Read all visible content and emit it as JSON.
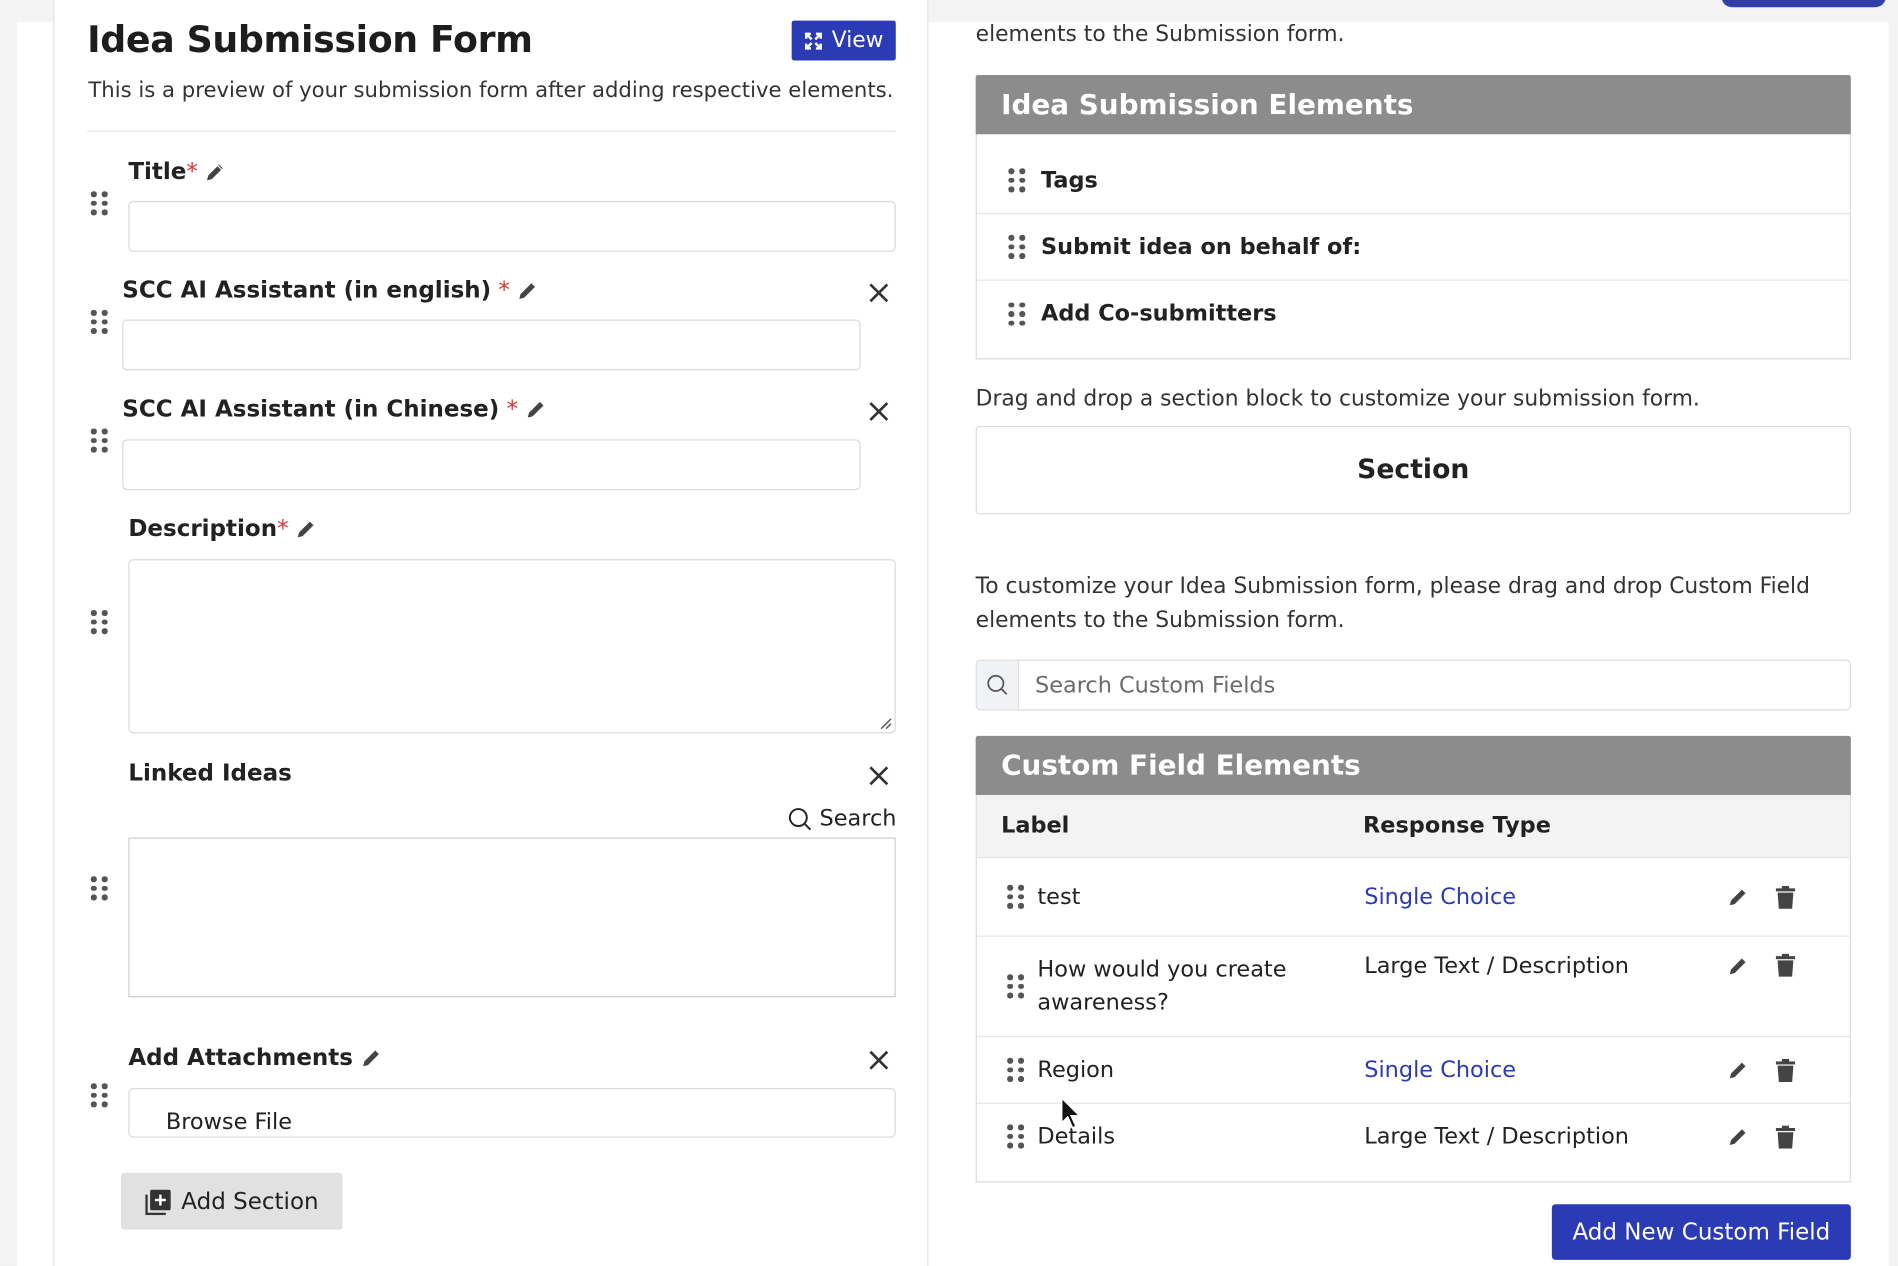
{
  "form": {
    "title": "Idea Submission Form",
    "subtitle": "This is a preview of your submission form after adding respective elements.",
    "view_label": "View",
    "add_section_label": "Add Section",
    "fields": {
      "title": {
        "label": "Title",
        "required_mark": "*"
      },
      "ai_en": {
        "label": "SCC AI Assistant (in english)",
        "required_mark": "*"
      },
      "ai_cn": {
        "label": "SCC AI Assistant (in Chinese)",
        "required_mark": "*"
      },
      "description": {
        "label": "Description",
        "required_mark": "*"
      },
      "linked": {
        "label": "Linked Ideas",
        "search_label": "Search"
      },
      "attachments": {
        "label": "Add Attachments",
        "browse_label": "Browse File"
      }
    }
  },
  "right": {
    "top_text": "elements to the Submission form.",
    "elements_panel": {
      "title": "Idea Submission Elements",
      "items": [
        "Tags",
        "Submit idea on behalf of:",
        "Add Co-submitters"
      ]
    },
    "drag_text": "Drag and drop a section block to customize your submission form.",
    "section_label": "Section",
    "customize_text": "To customize your Idea Submission form, please drag and drop Custom Field elements to the Submission form.",
    "search_placeholder": "Search Custom Fields",
    "custom_panel": {
      "title": "Custom Field Elements",
      "col_label": "Label",
      "col_type": "Response Type",
      "rows": [
        {
          "label": "test",
          "type": "Single Choice",
          "link": true
        },
        {
          "label": "How would you create awareness?",
          "type": "Large Text / Description",
          "link": false
        },
        {
          "label": "Region",
          "type": "Single Choice",
          "link": true
        },
        {
          "label": "Details",
          "type": "Large Text / Description",
          "link": false
        }
      ]
    },
    "add_custom_field_label": "Add New Custom Field"
  },
  "colors": {
    "primary": "#2b3ab5",
    "panel_header": "#8c8c8c",
    "required": "#d33333"
  },
  "icons": [
    "expand-icon",
    "drag-handle-icon",
    "pencil-icon",
    "close-icon",
    "search-icon",
    "add-box-icon",
    "trash-icon",
    "mouse-cursor-icon"
  ]
}
